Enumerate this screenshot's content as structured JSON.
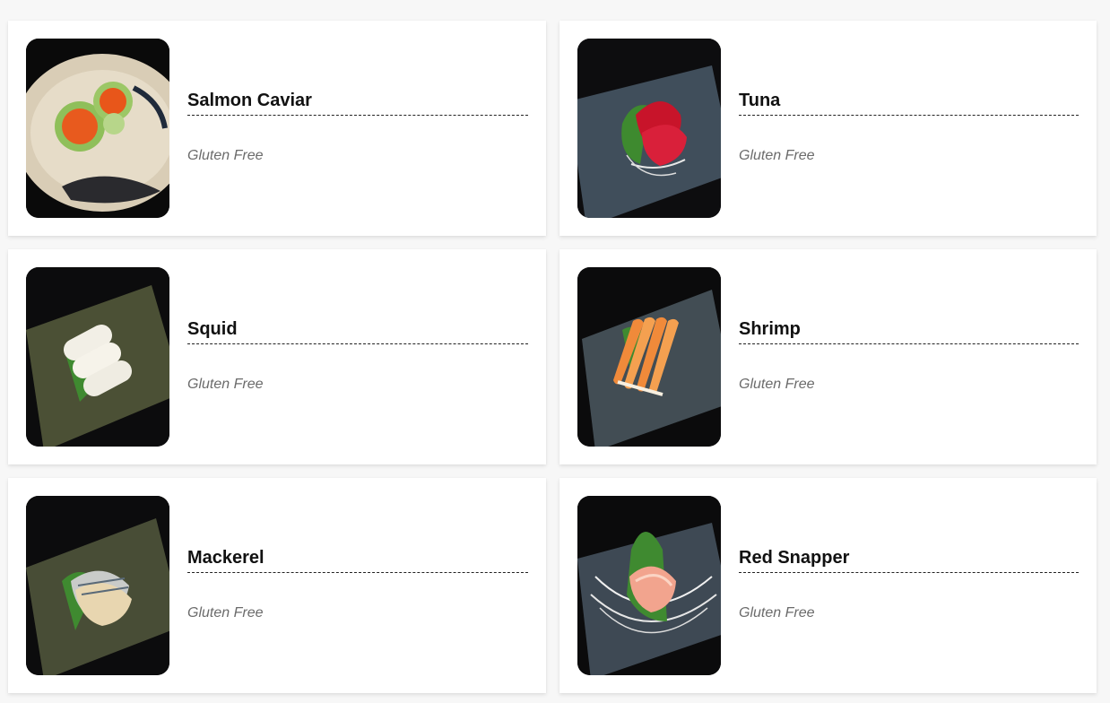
{
  "menu": {
    "items": [
      {
        "name": "Salmon Caviar",
        "tag": "Gluten Free",
        "photo": "salmon-caviar-photo"
      },
      {
        "name": "Tuna",
        "tag": "Gluten Free",
        "photo": "tuna-sashimi-photo"
      },
      {
        "name": "Squid",
        "tag": "Gluten Free",
        "photo": "squid-sashimi-photo"
      },
      {
        "name": "Shrimp",
        "tag": "Gluten Free",
        "photo": "shrimp-sashimi-photo"
      },
      {
        "name": "Mackerel",
        "tag": "Gluten Free",
        "photo": "mackerel-sashimi-photo"
      },
      {
        "name": "Red Snapper",
        "tag": "Gluten Free",
        "photo": "red-snapper-sashimi-photo"
      }
    ]
  },
  "colors": {
    "page_background": "#f7f7f7",
    "card_background": "#ffffff",
    "title_text": "#111111",
    "tag_text": "#6b6b6b"
  }
}
